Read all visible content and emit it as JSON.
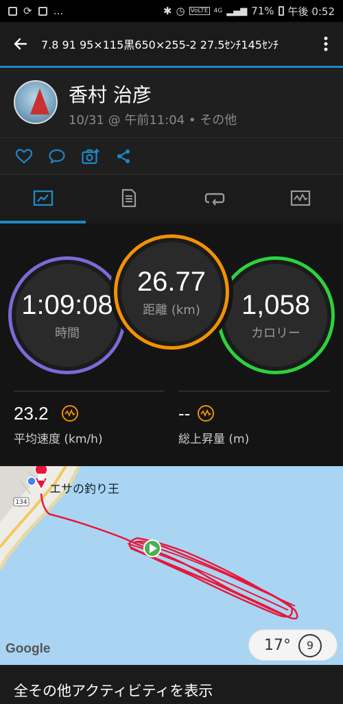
{
  "status_bar": {
    "battery": "71%",
    "time": "午後 0:52",
    "lte": "VoLTE",
    "signal_label": "4G"
  },
  "app_bar": {
    "title": "7.8 91 95×115黒650×255-2 27.5ｾﾝﾁ145ｾﾝﾁ"
  },
  "profile": {
    "name": "香村 治彦",
    "date": "10/31 @ 午前11:04 • その他"
  },
  "tabs": [
    "summary-tab",
    "details-tab",
    "laps-tab",
    "charts-tab"
  ],
  "stats": {
    "time": {
      "value": "1:09:08",
      "label": "時間",
      "color": "#7b6bd6"
    },
    "distance": {
      "value": "26.77",
      "label": "距離 (km)",
      "color": "#f39200"
    },
    "calories": {
      "value": "1,058",
      "label": "カロリー",
      "color": "#2bd33b"
    },
    "avg_speed": {
      "value": "23.2",
      "label": "平均速度 (km/h)"
    },
    "ascent": {
      "value": "--",
      "label": "総上昇量 (m)"
    }
  },
  "map": {
    "place": "エサの釣り王",
    "road": "134",
    "google": "Google",
    "weather_temp": "17°",
    "wind": "9"
  },
  "footer": {
    "label": "全その他アクティビティを表示"
  },
  "colors": {
    "accent": "#1e88c7",
    "track": "#e8173a",
    "water": "#a9d5f3"
  }
}
